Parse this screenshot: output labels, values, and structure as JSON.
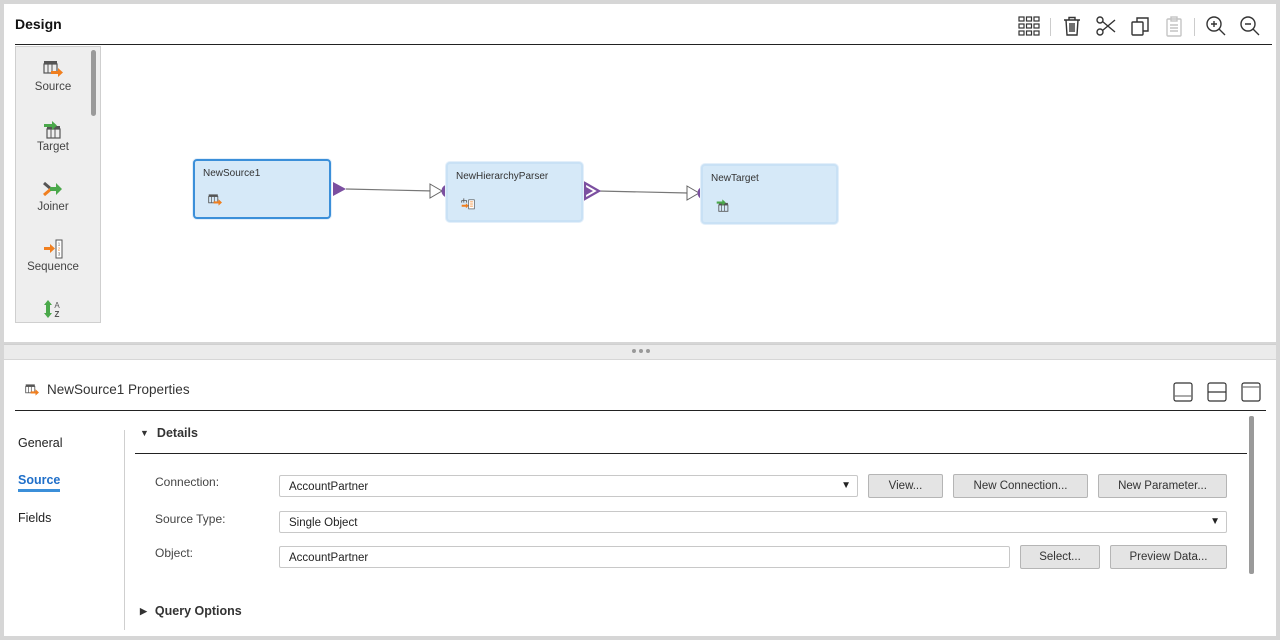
{
  "design": {
    "title": "Design",
    "toolbar": {
      "arrange_icon": "grid-icon",
      "delete_icon": "trash-icon",
      "cut_icon": "scissors-icon",
      "copy_icon": "copy-icon",
      "paste_icon": "clipboard-icon",
      "zoom_in_icon": "zoom-in-icon",
      "zoom_out_icon": "zoom-out-icon"
    },
    "palette": [
      {
        "label": "Source",
        "icon": "source-icon"
      },
      {
        "label": "Target",
        "icon": "target-icon"
      },
      {
        "label": "Joiner",
        "icon": "joiner-icon"
      },
      {
        "label": "Sequence",
        "icon": "sequence-icon"
      },
      {
        "label": "",
        "icon": "sorter-icon"
      }
    ],
    "nodes": [
      {
        "label": "NewSource1",
        "icon": "source-icon",
        "selected": true
      },
      {
        "label": "NewHierarchyParser",
        "icon": "hierarchy-parser-icon",
        "selected": false
      },
      {
        "label": "NewTarget",
        "icon": "target-icon",
        "selected": false
      }
    ],
    "colors": {
      "port": "#7b4fa0",
      "node_bg": "#d6e9f8",
      "selected_border": "#3b8fd9"
    }
  },
  "properties": {
    "title": "NewSource1 Properties",
    "tabs": [
      {
        "label": "General",
        "active": false
      },
      {
        "label": "Source",
        "active": true
      },
      {
        "label": "Fields",
        "active": false
      }
    ],
    "details": {
      "heading": "Details",
      "connection": {
        "label": "Connection:",
        "value": "AccountPartner"
      },
      "source_type": {
        "label": "Source Type:",
        "value": "Single Object"
      },
      "object": {
        "label": "Object:",
        "value": "AccountPartner"
      },
      "buttons": {
        "view": "View...",
        "new_connection": "New Connection...",
        "new_parameter": "New Parameter...",
        "select": "Select...",
        "preview_data": "Preview Data..."
      }
    },
    "query_options": {
      "heading": "Query Options"
    },
    "layout_buttons": [
      "minimize-panel-icon",
      "split-panel-icon",
      "maximize-panel-icon"
    ]
  }
}
